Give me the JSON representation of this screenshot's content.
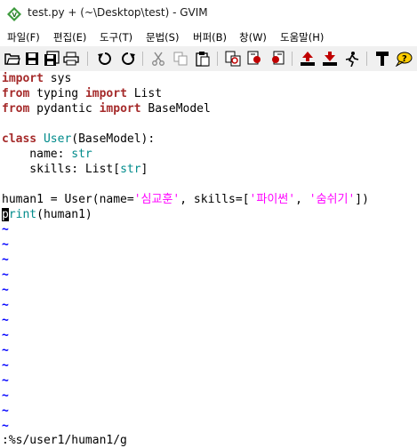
{
  "window": {
    "title": "test.py + (~\\Desktop\\test) - GVIM"
  },
  "menu": [
    "파일(F)",
    "편집(E)",
    "도구(T)",
    "문법(S)",
    "버퍼(B)",
    "창(W)",
    "도움말(H)"
  ],
  "toolbar": {
    "icons": [
      "open-icon",
      "save-icon",
      "save-all-icon",
      "print-icon",
      "undo-icon",
      "redo-icon",
      "cut-icon",
      "copy-icon",
      "paste-icon",
      "find-replace-icon",
      "find-next-icon",
      "find-prev-icon",
      "load-session-icon",
      "save-session-icon",
      "run-script-icon",
      "make-icon",
      "help-icon"
    ]
  },
  "editor": {
    "lines": {
      "l1_kw": "import",
      "l1_rest": " sys",
      "l2_kw": "from",
      "l2_mid": " typing ",
      "l2_kw2": "import",
      "l2_rest": " List",
      "l3_kw": "from",
      "l3_mid": " pydantic ",
      "l3_kw2": "import",
      "l3_rest": " BaseModel",
      "l5_kw": "class",
      "l5_sp": " ",
      "l5_cls": "User",
      "l5_rest": "(BaseModel):",
      "l6_pre": "    name: ",
      "l6_type": "str",
      "l7_pre": "    skills: List[",
      "l7_type": "str",
      "l7_post": "]",
      "l9_a": "human1 = User(name=",
      "l9_s1": "'심교훈'",
      "l9_b": ", skills=[",
      "l9_s2": "'파이썬'",
      "l9_c": ", ",
      "l9_s3": "'숨쉬기'",
      "l9_d": "])",
      "l10_cursor": "p",
      "l10_bi": "rint",
      "l10_rest": "(human1)"
    },
    "tilde": "~"
  },
  "command_line": ":%s/user1/human1/g"
}
